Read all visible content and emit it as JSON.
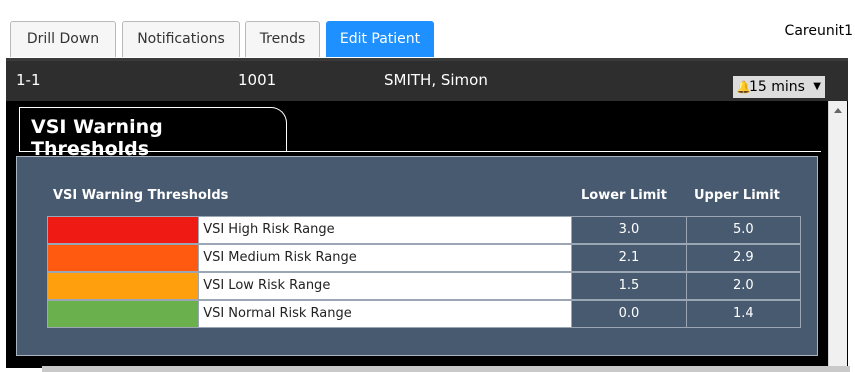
{
  "tabs": [
    {
      "label": "Drill Down",
      "active": false
    },
    {
      "label": "Notifications",
      "active": false
    },
    {
      "label": "Trends",
      "active": false
    },
    {
      "label": "Edit Patient",
      "active": true
    }
  ],
  "careunit": "Careunit1",
  "patient": {
    "bed": "1-1",
    "id": "1001",
    "name": "SMITH, Simon"
  },
  "alert_interval": {
    "icon": "bell-icon",
    "value": "15 mins"
  },
  "section_title": "VSI Warning Thresholds",
  "table": {
    "headers": {
      "name": "VSI Warning Thresholds",
      "lower": "Lower Limit",
      "upper": "Upper Limit"
    },
    "rows": [
      {
        "label": "VSI High Risk Range",
        "color": "#f01a15",
        "lower": "3.0",
        "upper": "5.0"
      },
      {
        "label": "VSI Medium Risk Range",
        "color": "#ff5a10",
        "lower": "2.1",
        "upper": "2.9"
      },
      {
        "label": "VSI Low Risk Range",
        "color": "#ff9f0e",
        "lower": "1.5",
        "upper": "2.0"
      },
      {
        "label": "VSI Normal Risk Range",
        "color": "#6ab04c",
        "lower": "0.0",
        "upper": "1.4"
      }
    ]
  }
}
